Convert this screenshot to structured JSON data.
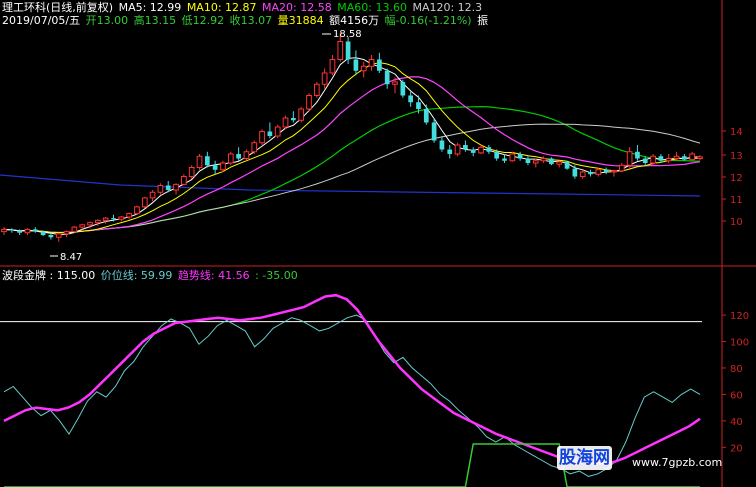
{
  "header": {
    "stock_title": "理工环科(日线,前复权)",
    "ma5": "MA5: 12.99",
    "ma10": "MA10: 12.87",
    "ma20": "MA20: 12.58",
    "ma60": "MA60: 13.60",
    "ma120": "MA120: 12.3",
    "date": "2019/07/05/五",
    "open": "开13.00",
    "high": "高13.15",
    "low": "低12.92",
    "close": "收13.07",
    "volume": "量31884",
    "amount": "额4156万",
    "change": "幅-0.16(-1.21%)",
    "extra": "振"
  },
  "colors": {
    "ma5": "#ffffff",
    "ma10": "#ffff00",
    "ma20": "#ff44ff",
    "ma60": "#00cc00",
    "ma120": "#cccccc",
    "up": "#ff3333",
    "down": "#44dddd",
    "trend": "#ff33ff",
    "price_line": "#66cccc",
    "axis": "#cc2222",
    "ref_line": "#ffffff",
    "green_signal": "#33cc33"
  },
  "annotations": {
    "high_label": "18.58",
    "low_label": "8.47"
  },
  "indicator_header": {
    "name": "波段金牌 : 115.00",
    "price_line": "价位线: 59.99",
    "trend_line": "趋势线: 41.56",
    "extra": ": -35.00"
  },
  "watermark": {
    "logo": "股海网",
    "url": "www.7gpzb.com"
  },
  "chart_data": [
    {
      "type": "candlestick",
      "ylim": [
        9.6,
        14.9
      ],
      "y_ticks": [
        10,
        11,
        12,
        13,
        14
      ],
      "candles": [
        [
          9.75,
          9.95,
          9.6,
          9.85
        ],
        [
          9.85,
          9.9,
          9.7,
          9.8
        ],
        [
          9.8,
          9.85,
          9.6,
          9.7
        ],
        [
          9.7,
          9.9,
          9.6,
          9.85
        ],
        [
          9.85,
          9.95,
          9.7,
          9.75
        ],
        [
          9.75,
          9.8,
          9.55,
          9.6
        ],
        [
          9.6,
          9.7,
          9.4,
          9.5
        ],
        [
          9.5,
          9.7,
          9.3,
          9.65
        ],
        [
          9.65,
          9.8,
          9.5,
          9.75
        ],
        [
          9.75,
          10.0,
          9.7,
          9.95
        ],
        [
          9.95,
          10.1,
          9.85,
          10.05
        ],
        [
          10.05,
          10.2,
          9.9,
          10.15
        ],
        [
          10.15,
          10.3,
          10.0,
          10.25
        ],
        [
          10.25,
          10.4,
          10.1,
          10.35
        ],
        [
          10.35,
          10.5,
          10.2,
          10.3
        ],
        [
          10.3,
          10.45,
          10.2,
          10.4
        ],
        [
          10.4,
          10.6,
          10.3,
          10.55
        ],
        [
          10.55,
          10.9,
          10.5,
          10.85
        ],
        [
          10.85,
          11.3,
          10.8,
          11.25
        ],
        [
          11.25,
          11.6,
          11.1,
          11.5
        ],
        [
          11.5,
          11.9,
          11.4,
          11.8
        ],
        [
          11.8,
          12.0,
          11.5,
          11.6
        ],
        [
          11.6,
          11.9,
          11.4,
          11.85
        ],
        [
          11.85,
          12.3,
          11.8,
          12.2
        ],
        [
          12.2,
          12.7,
          12.1,
          12.6
        ],
        [
          12.6,
          13.2,
          12.5,
          13.1
        ],
        [
          13.1,
          13.3,
          12.6,
          12.7
        ],
        [
          12.7,
          12.9,
          12.3,
          12.5
        ],
        [
          12.5,
          12.9,
          12.4,
          12.8
        ],
        [
          12.8,
          13.3,
          12.7,
          13.2
        ],
        [
          13.2,
          13.5,
          12.9,
          13.0
        ],
        [
          13.0,
          13.4,
          12.9,
          13.3
        ],
        [
          13.3,
          13.8,
          13.2,
          13.7
        ],
        [
          13.7,
          14.3,
          13.6,
          14.2
        ],
        [
          14.2,
          14.6,
          13.9,
          14.0
        ],
        [
          14.0,
          14.5,
          13.9,
          14.4
        ],
        [
          14.4,
          14.9,
          14.3,
          14.8
        ],
        [
          14.8,
          15.1,
          14.6,
          14.7
        ],
        [
          14.7,
          15.3,
          14.6,
          15.2
        ],
        [
          15.2,
          15.9,
          15.1,
          15.8
        ],
        [
          15.8,
          16.4,
          15.7,
          16.3
        ],
        [
          16.3,
          17.0,
          16.1,
          16.8
        ],
        [
          16.8,
          17.6,
          16.7,
          17.4
        ],
        [
          17.4,
          18.58,
          17.3,
          18.2
        ],
        [
          18.2,
          18.4,
          17.2,
          17.4
        ],
        [
          17.4,
          17.8,
          16.7,
          16.9
        ],
        [
          16.9,
          17.3,
          16.6,
          17.1
        ],
        [
          17.1,
          17.6,
          16.9,
          17.4
        ],
        [
          17.4,
          17.7,
          16.8,
          16.9
        ],
        [
          16.9,
          17.0,
          16.1,
          16.3
        ],
        [
          16.3,
          16.6,
          15.9,
          16.4
        ],
        [
          16.4,
          16.5,
          15.7,
          15.8
        ],
        [
          15.8,
          16.0,
          15.3,
          15.5
        ],
        [
          15.5,
          15.8,
          15.0,
          15.2
        ],
        [
          15.2,
          15.4,
          14.5,
          14.6
        ],
        [
          14.6,
          14.8,
          13.7,
          13.8
        ],
        [
          13.8,
          14.0,
          13.3,
          13.4
        ],
        [
          13.4,
          13.6,
          13.0,
          13.2
        ],
        [
          13.2,
          13.7,
          13.1,
          13.6
        ],
        [
          13.6,
          13.8,
          13.3,
          13.4
        ],
        [
          13.4,
          13.5,
          13.1,
          13.25
        ],
        [
          13.25,
          13.6,
          13.2,
          13.5
        ],
        [
          13.5,
          13.6,
          13.2,
          13.3
        ],
        [
          13.3,
          13.4,
          12.9,
          13.0
        ],
        [
          13.0,
          13.2,
          12.8,
          12.9
        ],
        [
          12.9,
          13.3,
          12.85,
          13.2
        ],
        [
          13.2,
          13.3,
          12.9,
          13.0
        ],
        [
          13.0,
          13.1,
          12.7,
          12.8
        ],
        [
          12.8,
          13.0,
          12.6,
          12.9
        ],
        [
          12.9,
          13.1,
          12.8,
          13.0
        ],
        [
          13.0,
          13.05,
          12.7,
          12.75
        ],
        [
          12.75,
          12.9,
          12.6,
          12.85
        ],
        [
          12.85,
          12.9,
          12.5,
          12.55
        ],
        [
          12.55,
          12.7,
          12.1,
          12.2
        ],
        [
          12.2,
          12.5,
          12.1,
          12.4
        ],
        [
          12.4,
          12.5,
          12.2,
          12.3
        ],
        [
          12.3,
          12.6,
          12.2,
          12.5
        ],
        [
          12.5,
          12.6,
          12.3,
          12.4
        ],
        [
          12.4,
          12.5,
          12.2,
          12.45
        ],
        [
          12.45,
          12.8,
          12.4,
          12.7
        ],
        [
          12.7,
          13.5,
          12.6,
          13.3
        ],
        [
          13.3,
          13.6,
          12.9,
          13.0
        ],
        [
          13.0,
          13.1,
          12.7,
          12.8
        ],
        [
          12.8,
          13.2,
          12.7,
          13.1
        ],
        [
          13.1,
          13.2,
          12.8,
          12.9
        ],
        [
          12.9,
          13.2,
          12.8,
          13.0
        ],
        [
          13.0,
          13.3,
          12.9,
          13.1
        ],
        [
          13.1,
          13.2,
          12.9,
          12.95
        ],
        [
          12.95,
          13.3,
          12.9,
          13.2
        ],
        [
          13.0,
          13.15,
          12.92,
          13.07
        ]
      ]
    },
    {
      "type": "line",
      "ylim": [
        -10,
        145
      ],
      "y_ticks": [
        20,
        40,
        60,
        80,
        100,
        120
      ],
      "reference": 115,
      "series": [
        {
          "name": "价位线",
          "values": [
            62,
            66,
            58,
            50,
            44,
            48,
            40,
            30,
            42,
            55,
            62,
            58,
            66,
            78,
            85,
            96,
            104,
            112,
            117,
            114,
            110,
            98,
            104,
            112,
            116,
            112,
            108,
            96,
            102,
            110,
            114,
            118,
            116,
            112,
            108,
            110,
            114,
            118,
            120,
            116,
            104,
            92,
            84,
            88,
            80,
            74,
            68,
            60,
            55,
            48,
            42,
            36,
            28,
            24,
            28,
            22,
            18,
            14,
            10,
            6,
            4,
            0,
            2,
            -2,
            0,
            4,
            10,
            24,
            42,
            58,
            62,
            58,
            54,
            60,
            64,
            60
          ]
        },
        {
          "name": "趋势线",
          "values": [
            40,
            44,
            48,
            50,
            49,
            48,
            50,
            54,
            60,
            68,
            76,
            84,
            92,
            100,
            106,
            110,
            114,
            115,
            116,
            117,
            118,
            117,
            116,
            117,
            118,
            120,
            122,
            124,
            126,
            130,
            134,
            135,
            132,
            124,
            112,
            100,
            90,
            80,
            72,
            64,
            58,
            52,
            46,
            42,
            38,
            34,
            30,
            27,
            24,
            21,
            18,
            15,
            12,
            10,
            9,
            8,
            8,
            9,
            12,
            16,
            20,
            24,
            28,
            32,
            36,
            41.56
          ]
        }
      ],
      "signal": {
        "y": [
          0,
          0,
          0,
          0,
          0,
          0,
          0,
          0,
          0,
          0,
          0,
          0,
          0,
          0,
          0,
          0,
          0,
          0,
          0,
          0,
          0,
          0,
          0,
          0,
          0,
          0,
          0,
          0,
          0,
          0,
          0,
          0,
          0,
          0,
          0,
          0,
          0,
          0,
          0,
          0,
          0,
          0,
          0,
          0,
          0,
          0,
          0,
          0,
          0,
          0,
          0,
          0,
          0,
          0,
          0,
          0,
          0,
          0,
          0,
          0,
          1,
          1,
          1,
          1,
          1,
          1,
          1,
          1,
          1,
          1,
          1,
          1,
          0,
          0,
          0,
          0,
          0,
          0,
          0,
          0,
          0,
          0,
          0,
          0,
          0,
          0,
          0,
          0,
          0,
          0
        ]
      }
    }
  ]
}
